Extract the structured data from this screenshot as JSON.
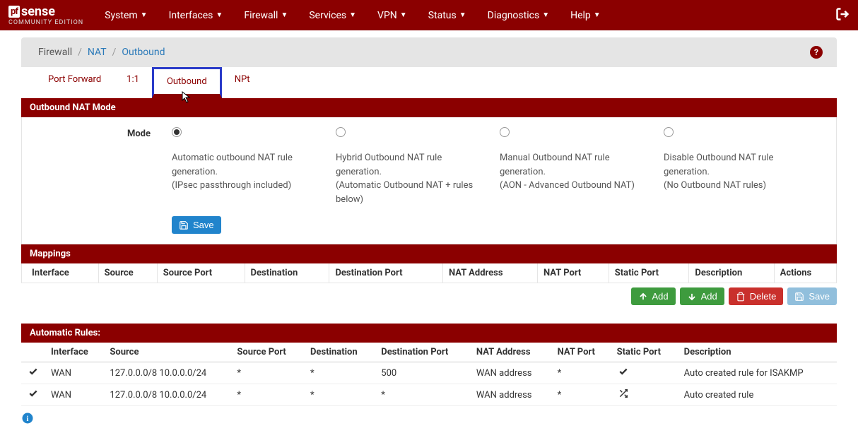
{
  "logo": {
    "pf": "pf",
    "sense": "sense",
    "sub": "COMMUNITY EDITION"
  },
  "nav": {
    "system": "System",
    "interfaces": "Interfaces",
    "firewall": "Firewall",
    "services": "Services",
    "vpn": "VPN",
    "status": "Status",
    "diagnostics": "Diagnostics",
    "help": "Help"
  },
  "breadcrumb": {
    "item0": "Firewall",
    "item1": "NAT",
    "item2": "Outbound"
  },
  "tabs": {
    "portforward": "Port Forward",
    "oneone": "1:1",
    "outbound": "Outbound",
    "npt": "NPt"
  },
  "panel1": {
    "title": "Outbound NAT Mode",
    "label": "Mode",
    "opt0": {
      "line1": "Automatic outbound NAT rule generation.",
      "line2": "(IPsec passthrough included)"
    },
    "opt1": {
      "line1": "Hybrid Outbound NAT rule generation.",
      "line2": "(Automatic Outbound NAT + rules below)"
    },
    "opt2": {
      "line1": "Manual Outbound NAT rule generation.",
      "line2": "(AON - Advanced Outbound NAT)"
    },
    "opt3": {
      "line1": "Disable Outbound NAT rule generation.",
      "line2": "(No Outbound NAT rules)"
    },
    "save": "Save"
  },
  "mappings": {
    "title": "Mappings",
    "cols": {
      "interface": "Interface",
      "source": "Source",
      "srcport": "Source Port",
      "dest": "Destination",
      "dstport": "Destination Port",
      "nataddr": "NAT Address",
      "natport": "NAT Port",
      "staticport": "Static Port",
      "desc": "Description",
      "actions": "Actions"
    }
  },
  "actions": {
    "add1": "Add",
    "add2": "Add",
    "delete": "Delete",
    "save": "Save"
  },
  "auto": {
    "title": "Automatic Rules:",
    "cols": {
      "interface": "Interface",
      "source": "Source",
      "srcport": "Source Port",
      "dest": "Destination",
      "dstport": "Destination Port",
      "nataddr": "NAT Address",
      "natport": "NAT Port",
      "staticport": "Static Port",
      "desc": "Description"
    },
    "rows": [
      {
        "interface": "WAN",
        "source": "127.0.0.0/8 10.0.0.0/24",
        "srcport": "*",
        "dest": "*",
        "dstport": "500",
        "nataddr": "WAN address",
        "natport": "*",
        "static": "check",
        "desc": "Auto created rule for ISAKMP"
      },
      {
        "interface": "WAN",
        "source": "127.0.0.0/8 10.0.0.0/24",
        "srcport": "*",
        "dest": "*",
        "dstport": "*",
        "nataddr": "WAN address",
        "natport": "*",
        "static": "shuffle",
        "desc": "Auto created rule"
      }
    ]
  }
}
